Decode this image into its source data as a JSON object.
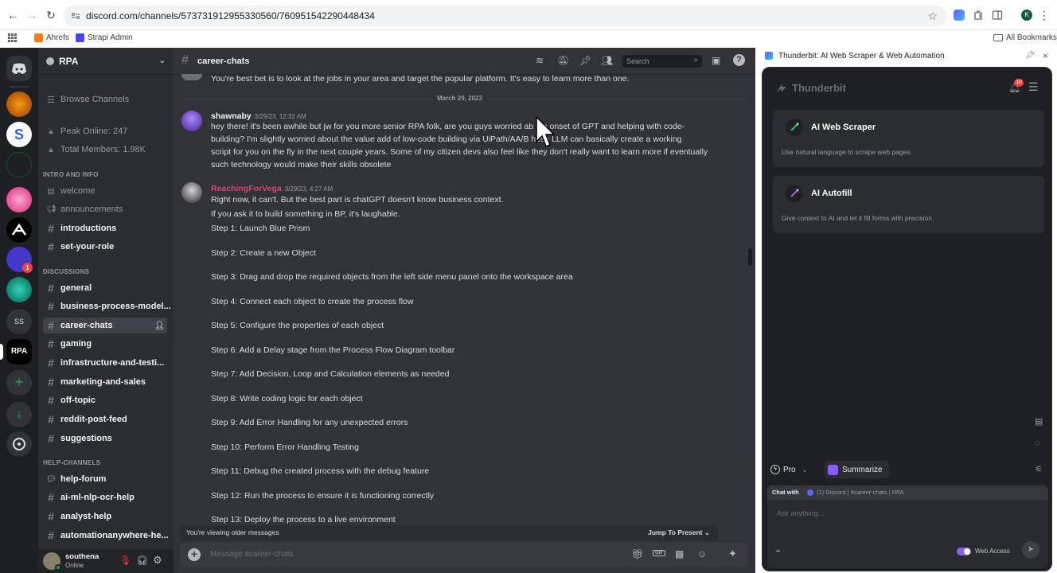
{
  "browser": {
    "url": "discord.com/channels/573731912955330560/760951542290448434",
    "bookmarks": [
      "Ahrefs",
      "Strapi Admin"
    ],
    "all_bookmarks": "All Bookmarks",
    "profile_initial": "K"
  },
  "server": {
    "name": "RPA",
    "browse": "Browse Channels",
    "peak_online": "Peak Online: 247",
    "total_members": "Total Members: 1.98K",
    "categories": {
      "intro": "INTRO AND INFO",
      "discussions": "DISCUSSIONS",
      "help": "HELP-CHANNELS"
    },
    "intro_channels": [
      "welcome",
      "announcements",
      "introductions",
      "set-your-role"
    ],
    "discussion_channels": [
      "general",
      "business-process-model...",
      "career-chats",
      "gaming",
      "infrastructure-and-testi...",
      "marketing-and-sales",
      "off-topic",
      "reddit-post-feed",
      "suggestions"
    ],
    "help_channels": [
      "help-forum",
      "ai-ml-nlp-ocr-help",
      "analyst-help",
      "automationanywhere-he..."
    ],
    "guild_badge": "1",
    "guild_ss": "SS",
    "guild_rpa": "RPA"
  },
  "user": {
    "name": "southena",
    "status": "Online"
  },
  "channel": {
    "name": "career-chats",
    "search_placeholder": "Search"
  },
  "messages": {
    "top_line": "You're best bet is to look at the jobs in your area and target the popular platform. It's easy to learn more than one.",
    "date_divider": "March 29, 2023",
    "m1_author": "shawnaby",
    "m1_time": "3/29/23, 12:32 AM",
    "m1_lines": [
      "hey there! it's been awhile but jw for you more senior RPA folk, are you guys worried ab   the onset of GPT and helping with code-",
      "building? I'm slightly worried about the value add of low-code building via UiPath/AA/B   hese LLM can basically create a working",
      "script for you on the fly in the next couple years. Some of my citizen devs also feel like they don't really want to learn more if eventually",
      "such technology would make their skills obsolete"
    ],
    "m2_author": "ReachingForVega",
    "m2_time": "3/29/23, 4:27 AM",
    "m2_lines": [
      "Right now, it can't. But the best part is chatGPT doesn't know business context.",
      "If you ask it to build something in BP, it's laughable."
    ],
    "steps": [
      "Step 1: Launch Blue Prism",
      "Step 2: Create a new Object",
      "Step 3: Drag and drop the required objects from the left side menu panel onto the workspace area",
      "Step 4: Connect each object to create the process flow",
      "Step 5: Configure the properties of each object",
      "Step 6: Add a Delay stage from the Process Flow Diagram toolbar",
      "Step 7: Add Decision, Loop and Calculation elements as needed",
      "Step 8: Write coding logic for each object",
      "Step 9: Add Error Handling for any unexpected errors",
      "Step 10: Perform Error Handling Testing",
      "Step 11: Debug the created process with the debug feature",
      "Step 12: Run the process to ensure it is functioning correctly",
      "Step 13: Deploy the process to a live environment"
    ],
    "older_notice": "You're viewing older messages",
    "jump": "Jump To Present",
    "composer_placeholder": "Message #career-chats",
    "gif": "GIF"
  },
  "thunderbit": {
    "ext_title": "Thunderbit: AI Web Scraper & Web Automation",
    "brand": "Thunderbit",
    "notif_count": "10",
    "cards": [
      {
        "title": "AI Web Scraper",
        "desc": "Use natural language to scrape web pages."
      },
      {
        "title": "AI Autofill",
        "desc": "Give context to AI and let it fill forms with precision."
      }
    ],
    "pro": "Pro",
    "summarize": "Summarize",
    "chat_with": "Chat with",
    "chat_context": "(1) Discord | #career-chats | RPA",
    "ask_placeholder": "Ask anything...",
    "web_access": "Web Access",
    "accent": "#8b5cf6"
  }
}
